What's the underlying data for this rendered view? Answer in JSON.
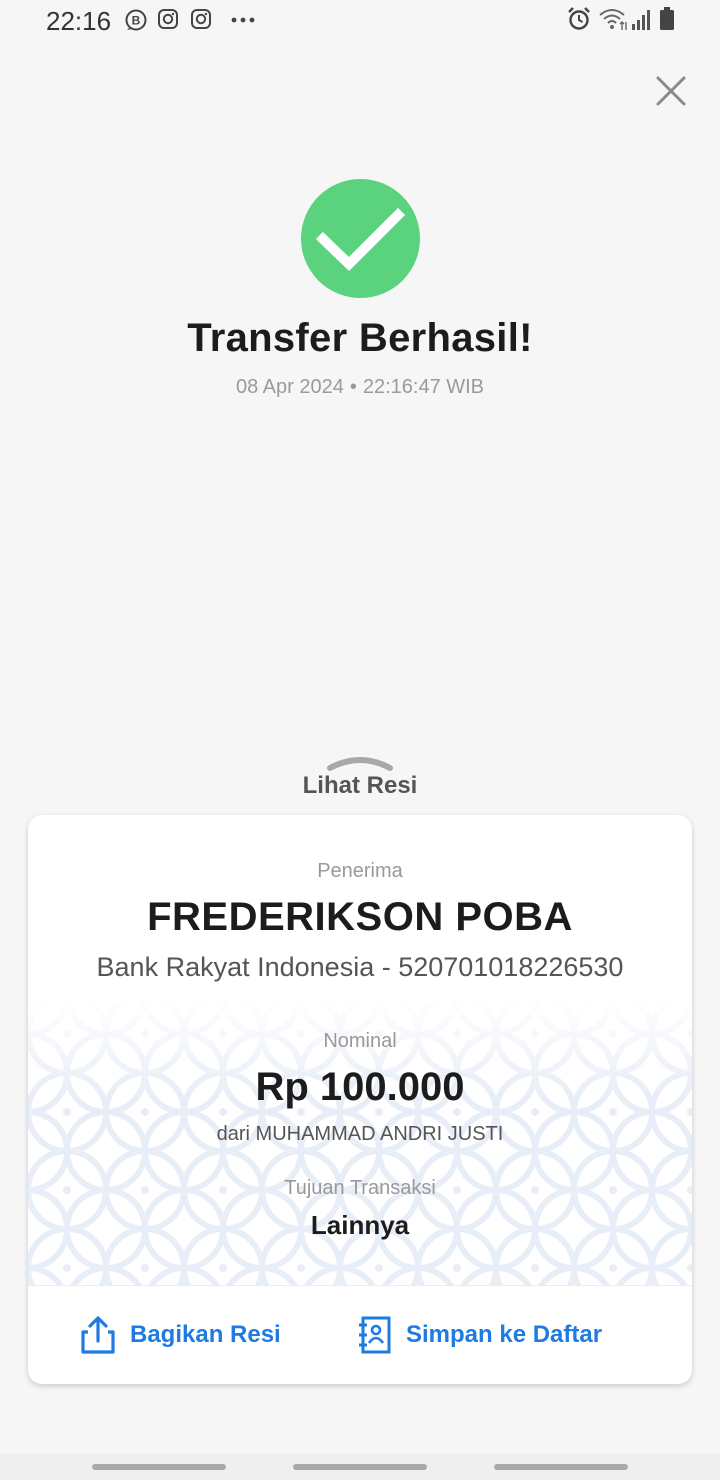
{
  "status_bar": {
    "time": "22:16",
    "left_icons": [
      "bip-icon",
      "instagram-icon",
      "instagram-icon",
      "more-dots-icon"
    ],
    "right_icons": [
      "alarm-icon",
      "wifi-icon",
      "signal-icon",
      "battery-icon"
    ]
  },
  "header": {
    "title": "Transfer Berhasil!",
    "date": "08 Apr 2024",
    "separator": "•",
    "time": "22:16:47 WIB",
    "success_color": "#5bd27d"
  },
  "receipt_toggle": {
    "label": "Lihat Resi"
  },
  "receipt": {
    "recipient_label": "Penerima",
    "recipient_name": "FREDERIKSON POBA",
    "bank_account": "Bank Rakyat Indonesia - 520701018226530",
    "amount_label": "Nominal",
    "amount": "Rp 100.000",
    "sender": "dari MUHAMMAD ANDRI JUSTI",
    "purpose_label": "Tujuan Transaksi",
    "purpose": "Lainnya"
  },
  "actions": {
    "share_label": "Bagikan Resi",
    "save_label": "Simpan ke Daftar",
    "accent_color": "#1f7be0"
  }
}
